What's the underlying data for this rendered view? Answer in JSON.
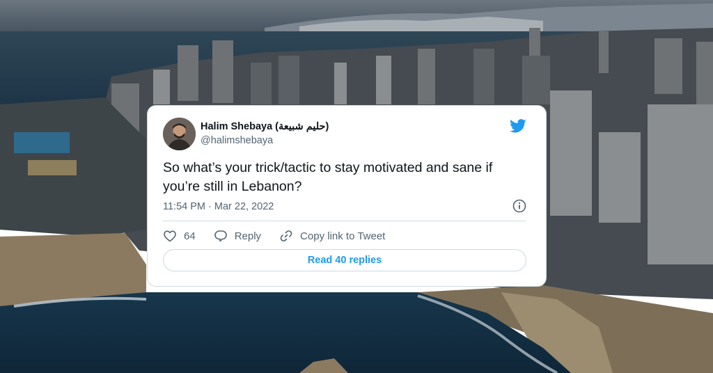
{
  "tweet": {
    "author_name": "Halim Shebaya (حليم شبيعة)",
    "author_handle": "@halimshebaya",
    "text": "So what’s your trick/tactic to stay motivated and sane if you’re still in Lebanon?",
    "timestamp": "11:54 PM · Mar 22, 2022",
    "like_count": "64",
    "reply_label": "Reply",
    "copy_link_label": "Copy link to Tweet",
    "read_replies_label": "Read 40 replies"
  },
  "colors": {
    "accent": "#1d9bf0",
    "text_primary": "#0f1419",
    "text_secondary": "#536471",
    "border": "#cfd9de"
  },
  "icons": [
    "twitter-bird-icon",
    "info-icon",
    "heart-icon",
    "reply-icon",
    "link-icon"
  ]
}
